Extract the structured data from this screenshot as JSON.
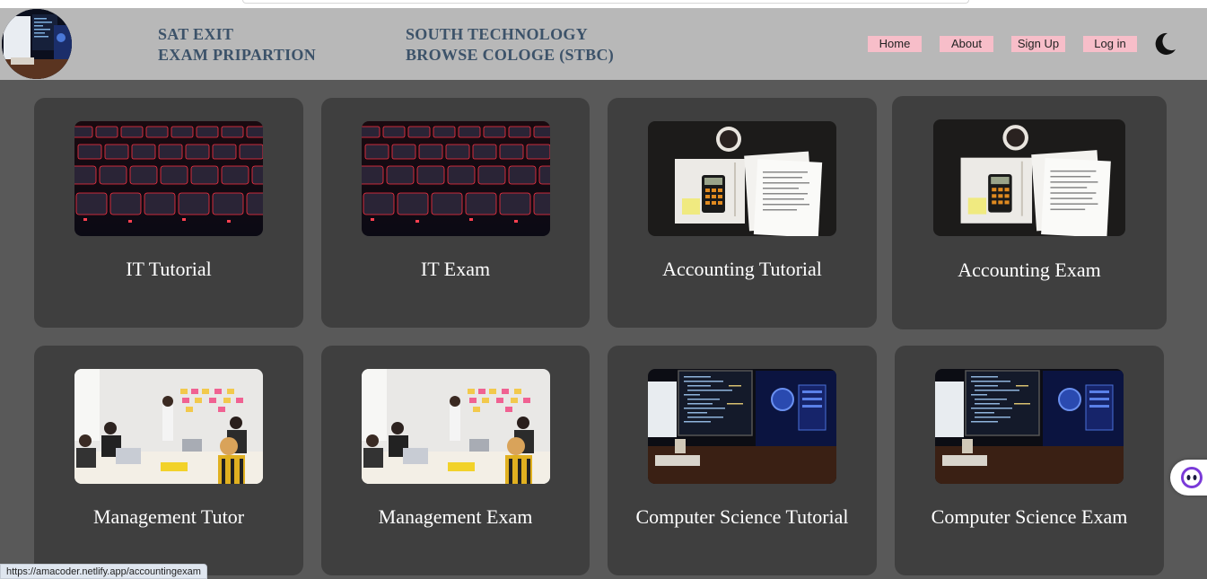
{
  "header": {
    "title_left_line1": "SAT EXIT",
    "title_left_line2": "EXAM PRIPARTION",
    "title_right_line1": "SOUTH TECHNOLOGY",
    "title_right_line2": "BROWSE COLOGE (STBC)"
  },
  "nav": {
    "home": "Home",
    "about": "About",
    "signup": "Sign Up",
    "login": "Log in",
    "theme_icon": "moon-icon"
  },
  "cards": [
    {
      "label": "IT Tutorial",
      "image": "red-keyboard"
    },
    {
      "label": "IT Exam",
      "image": "red-keyboard"
    },
    {
      "label": "Accounting Tutorial",
      "image": "tax-forms-calculator"
    },
    {
      "label": "Accounting Exam",
      "image": "tax-forms-calculator"
    },
    {
      "label": "Management Tutor",
      "image": "team-meeting"
    },
    {
      "label": "Management Exam",
      "image": "team-meeting"
    },
    {
      "label": "Computer Science Tutorial",
      "image": "computer-monitors"
    },
    {
      "label": "Computer Science Exam",
      "image": "computer-monitors"
    }
  ],
  "status_url": "https://amacoder.netlify.app/accountingexam",
  "colors": {
    "page_bg": "#595959",
    "header_bg": "#b8b8b8",
    "card_bg": "#3f3f3f",
    "title_color": "#3c5269",
    "nav_bg": "#f7bec9"
  }
}
